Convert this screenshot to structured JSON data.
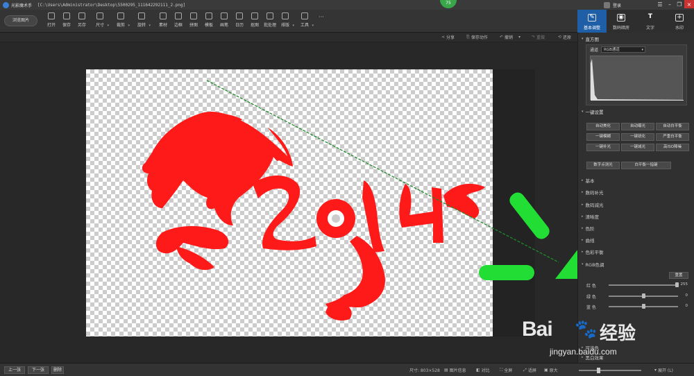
{
  "titlebar": {
    "app_name": "光影魔术手",
    "path": "[C:\\Users\\Administrator\\Desktop\\5500295_111642292111_2.png]",
    "badge": "75",
    "login": "登录"
  },
  "toolbar": {
    "browse": "浏览图片",
    "tools": [
      "打开",
      "保存",
      "另存",
      "尺寸",
      "裁剪",
      "旋转",
      "素材",
      "边框",
      "拼图",
      "模板",
      "画笔",
      "日历",
      "抠图",
      "批处理",
      "排版",
      "工具"
    ],
    "more": "···"
  },
  "right_tabs": [
    {
      "label": "基本调整",
      "icon": "adjust-icon"
    },
    {
      "label": "数码暗房",
      "icon": "camera-icon"
    },
    {
      "label": "文字",
      "icon": "text-icon"
    },
    {
      "label": "水印",
      "icon": "watermark-icon"
    }
  ],
  "actions": {
    "share": "分享",
    "save_action": "保存动作",
    "undo": "撤销",
    "redo": "重做",
    "restore": "还原"
  },
  "panel": {
    "histogram": {
      "title": "直方图",
      "channel_label": "通道",
      "channel_value": "RGB通道"
    },
    "onekey": {
      "title": "一键设置",
      "buttons": [
        "自动美化",
        "自动曝光",
        "自动白平衡",
        "一键模糊",
        "一键锐化",
        "严重白平衡",
        "一键补光",
        "一键减光",
        "高ISO降噪"
      ],
      "wide_buttons": [
        "数字点测光",
        "白平衡一指键"
      ]
    },
    "sections": [
      "基本",
      "数码补光",
      "数码减光",
      "清晰度",
      "色阶",
      "曲线",
      "色彩平衡"
    ],
    "rgb": {
      "title": "RGB色调",
      "reset": "重置",
      "rows": [
        {
          "label": "红    色",
          "value": "255",
          "level": 1.0
        },
        {
          "label": "绿    色",
          "value": "0",
          "level": 0.5
        },
        {
          "label": "蓝    色",
          "value": "0",
          "level": 0.5
        }
      ]
    },
    "bottom_sections": [
      "可选色",
      "黑白效果"
    ]
  },
  "status": {
    "prev": "上一张",
    "next": "下一张",
    "delete": "删除",
    "size": "尺寸: 803×528",
    "info": "图片信息",
    "compare": "对比",
    "fullscreen": "全屏",
    "fit": "适屏",
    "original": "原大",
    "expand": "展开 (L)"
  },
  "watermark": {
    "logo": "Bai",
    "logo2": "经验",
    "url": "jingyan.baidu.com"
  },
  "canvas_art": {
    "text": "2014",
    "color": "#ff1a1a"
  },
  "colors": {
    "accent": "#1f5fa8",
    "arrow": "#22dd33",
    "guide": "#1e8a2a"
  }
}
